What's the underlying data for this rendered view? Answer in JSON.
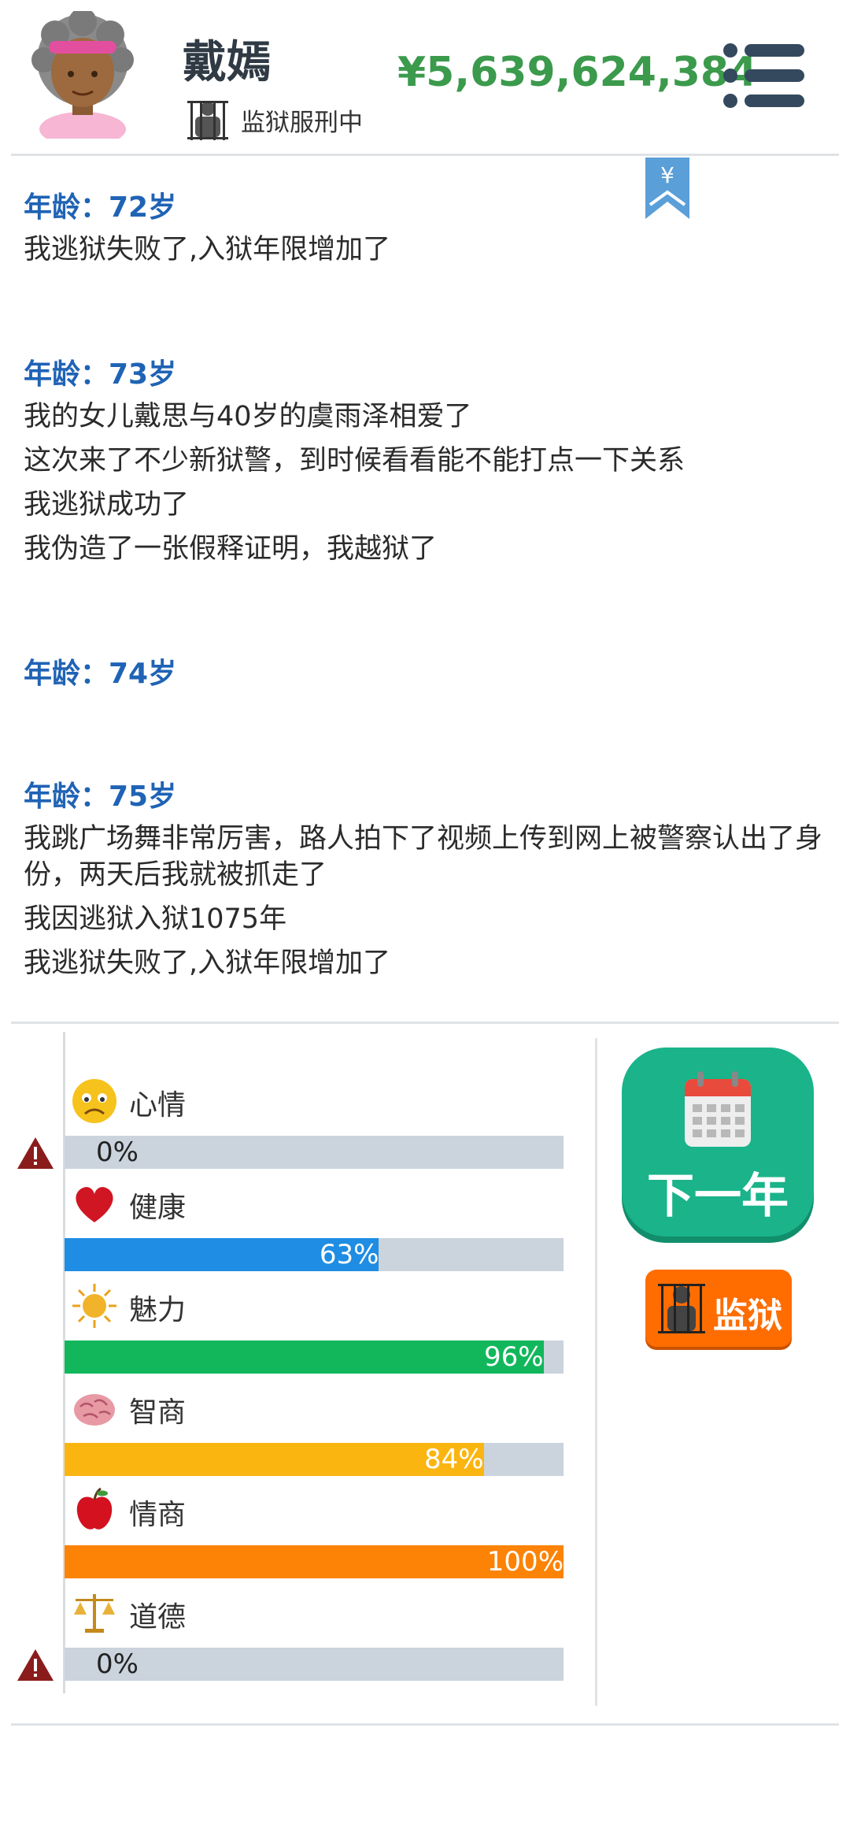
{
  "header": {
    "name": "戴嫣",
    "status": "监狱服刑中",
    "money": "¥5,639,624,384"
  },
  "bookmark_symbol": "¥",
  "log": [
    {
      "year": "年龄：72岁",
      "lines": [
        "我逃狱失败了,入狱年限增加了"
      ]
    },
    {
      "year": "年龄：73岁",
      "lines": [
        "我的女儿戴思与40岁的虞雨泽相爱了",
        "这次来了不少新狱警，到时候看看能不能打点一下关系",
        "我逃狱成功了",
        "我伪造了一张假释证明，我越狱了"
      ]
    },
    {
      "year": "年龄：74岁",
      "lines": []
    },
    {
      "year": "年龄：75岁",
      "lines": [
        "我跳广场舞非常厉害，路人拍下了视频上传到网上被警察认出了身份，两天后我就被抓走了",
        "我因逃狱入狱1075年",
        "我逃狱失败了,入狱年限增加了"
      ]
    }
  ],
  "stats": [
    {
      "key": "mood",
      "label": "心情",
      "value": 0,
      "display": "0%",
      "color": "#2f8be0",
      "warn": true,
      "icon": "sad-face-icon"
    },
    {
      "key": "health",
      "label": "健康",
      "value": 63,
      "display": "63%",
      "color": "#1e8de3",
      "warn": false,
      "icon": "heart-icon"
    },
    {
      "key": "charm",
      "label": "魅力",
      "value": 96,
      "display": "96%",
      "color": "#12b75c",
      "warn": false,
      "icon": "sun-icon"
    },
    {
      "key": "iq",
      "label": "智商",
      "value": 84,
      "display": "84%",
      "color": "#fbb511",
      "warn": false,
      "icon": "brain-icon"
    },
    {
      "key": "eq",
      "label": "情商",
      "value": 100,
      "display": "100%",
      "color": "#fc8305",
      "warn": false,
      "icon": "apple-icon"
    },
    {
      "key": "morality",
      "label": "道德",
      "value": 0,
      "display": "0%",
      "color": "#888888",
      "warn": true,
      "icon": "scales-icon"
    }
  ],
  "actions": {
    "next_year": "下一年",
    "prison": "监狱"
  },
  "colors": {
    "money": "#3b9a4c",
    "year_heading": "#1f63b5",
    "next_button": "#1ab38a",
    "prison_button": "#ff6d00"
  }
}
